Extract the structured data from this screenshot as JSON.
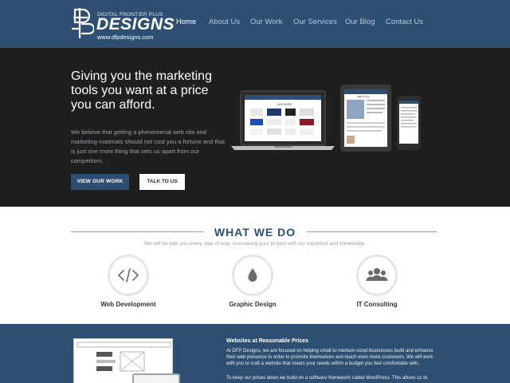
{
  "brand": {
    "tagline": "DIGITAL FRONTIER PLUS",
    "wordmark": "DESIGNS",
    "url": "www.dfpdesigns.com",
    "color": "#2f4f72"
  },
  "nav": {
    "items": [
      {
        "label": "Home",
        "active": true
      },
      {
        "label": "About Us",
        "active": false
      },
      {
        "label": "Our Work",
        "active": false
      },
      {
        "label": "Our Services",
        "active": false
      },
      {
        "label": "Our Blog",
        "active": false
      },
      {
        "label": "Contact Us",
        "active": false
      }
    ]
  },
  "hero": {
    "heading": "Giving you the marketing tools you want at a price you can afford.",
    "body": "We believe that getting a phenomenal web site and marketing materials should not cost you a fortune and that is just one more thing that sets us apart from our competitors.",
    "primary_button": "VIEW OUR WORK",
    "secondary_button": "TALK TO US",
    "mockup_header": "OUR WORK",
    "mockup_tablet_title": "ABOUT US"
  },
  "what_we_do": {
    "title": "WHAT WE DO",
    "subtitle": "We will be with you every step of way, overseeing your project with our expertise and knowledge.",
    "services": [
      {
        "label": "Web Development",
        "icon": "code-icon"
      },
      {
        "label": "Graphic Design",
        "icon": "ink-drop-icon"
      },
      {
        "label": "IT Consulting",
        "icon": "users-icon"
      }
    ]
  },
  "about": {
    "heading": "Websites at Reasonable Prices",
    "paragraph1": "At DFP Designs, we are focused on helping small to medium-sized businesses build and enhance their web presence in order to promote themselves and reach even more customers. We will work with you to craft a website that meets your needs within a budget you feel comfortable with.",
    "paragraph2": "To keep our prices down we build on a software framework called WordPress. This allows us to"
  }
}
